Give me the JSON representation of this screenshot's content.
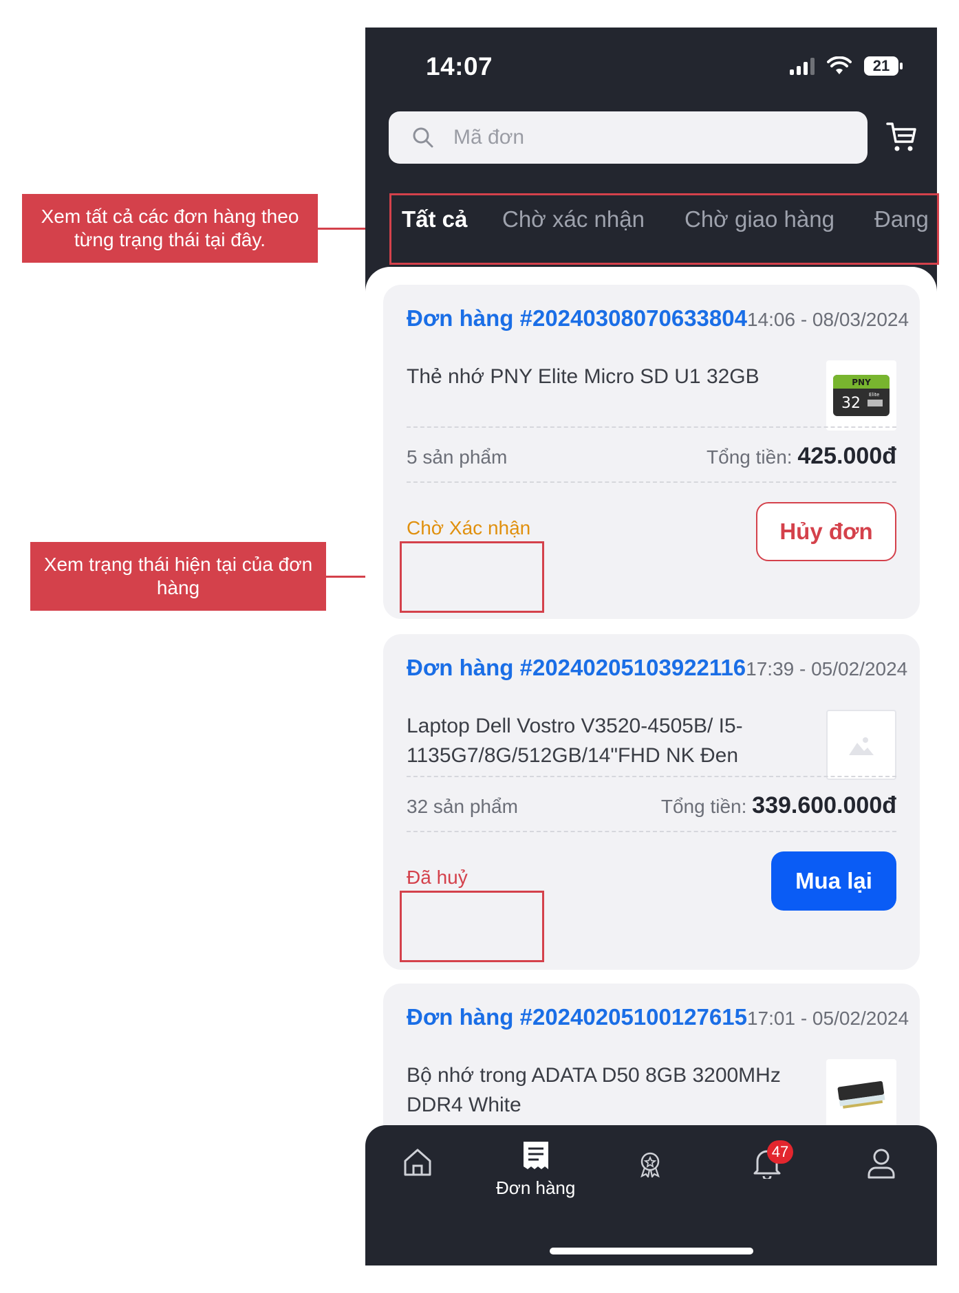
{
  "annotations": {
    "tabs_note": "Xem tất cả các đơn hàng theo từng trạng thái tại đây.",
    "status_note": "Xem trạng thái hiện tại của đơn hàng"
  },
  "status_bar": {
    "time": "14:07",
    "battery": "21"
  },
  "search": {
    "placeholder": "Mã đơn"
  },
  "tabs": [
    {
      "label": "Tất cả",
      "active": true
    },
    {
      "label": "Chờ xác nhận",
      "active": false
    },
    {
      "label": "Chờ giao hàng",
      "active": false
    },
    {
      "label": "Đang",
      "active": false
    }
  ],
  "orders": [
    {
      "id": "Đơn hàng #20240308070633804",
      "time": "14:06 - 08/03/2024",
      "product": "Thẻ nhớ PNY Elite Micro SD U1 32GB",
      "count": "5 sản phẩm",
      "total_label": "Tổng tiền:",
      "total": "425.000đ",
      "status": "Chờ Xác nhận",
      "status_color": "#e0900e",
      "action": "Hủy đơn",
      "thumb": {
        "brand": "PNY",
        "capacity": "32",
        "tag": "Elite"
      }
    },
    {
      "id": "Đơn hàng #20240205103922116",
      "time": "17:39 - 05/02/2024",
      "product": "Laptop Dell Vostro V3520-4505B/ I5-1135G7/8G/512GB/14\"FHD NK Đen",
      "count": "32 sản phẩm",
      "total_label": "Tổng tiền:",
      "total": "339.600.000đ",
      "status": "Đã huỷ",
      "status_color": "#d4414b",
      "action": "Mua lại"
    },
    {
      "id": "Đơn hàng #20240205100127615",
      "time": "17:01 - 05/02/2024",
      "product": "Bộ nhớ trong ADATA D50 8GB 3200MHz DDR4 White"
    }
  ],
  "tabbar": {
    "orders_label": "Đơn hàng",
    "notification_count": "47"
  },
  "colors": {
    "accent": "#1a6ee6",
    "annotation": "#d4414b",
    "dark_bg": "#23262f",
    "primary_button": "#0a5cf5"
  }
}
